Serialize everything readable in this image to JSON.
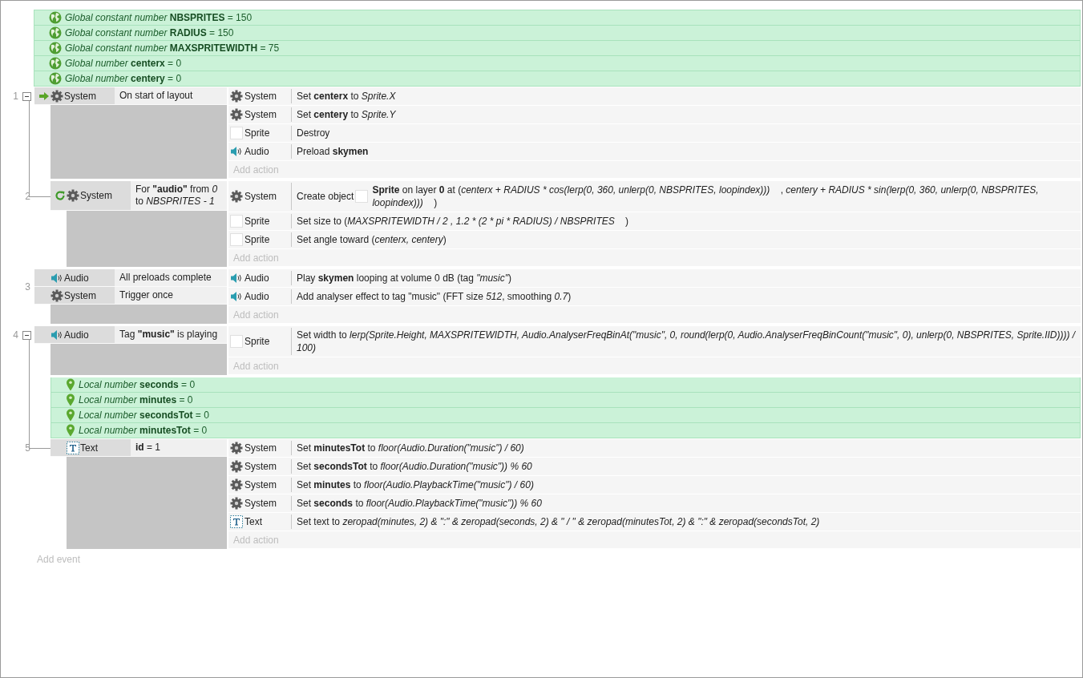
{
  "sheet": [
    {
      "kind": "global",
      "text": "*Global constant number* **NBSPRITES** = 150"
    },
    {
      "kind": "global",
      "text": "*Global constant number* **RADIUS** = 150"
    },
    {
      "kind": "global",
      "text": "*Global constant number* **MAXSPRITEWIDTH** = 75"
    },
    {
      "kind": "global",
      "text": "*Global number* **centerx** = 0"
    },
    {
      "kind": "global",
      "text": "*Global number* **centery** = 0"
    },
    {
      "kind": "event",
      "number": "1",
      "expanded": true,
      "conditions": [
        {
          "trigger": true,
          "loop": false,
          "kind": "system",
          "object": "System",
          "text": "On start of layout"
        }
      ],
      "actions": [
        {
          "kind": "system",
          "object": "System",
          "text": "Set **centerx** to *Sprite.X*"
        },
        {
          "kind": "system",
          "object": "System",
          "text": "Set **centery** to *Sprite.Y*"
        },
        {
          "kind": "sprite",
          "object": "Sprite",
          "text": "Destroy"
        },
        {
          "kind": "audio",
          "object": "Audio",
          "text": "Preload **skymen**"
        }
      ],
      "add_action": "Add action",
      "children": [
        {
          "kind": "event",
          "number": "2",
          "conditions": [
            {
              "trigger": false,
              "loop": true,
              "kind": "system",
              "object": "System",
              "text": "For **\"audio\"** from *0* to *NBSPRITES - 1*"
            }
          ],
          "actions": [
            {
              "kind": "system",
              "object": "System",
              "text_before": "Create object",
              "inline": {
                "kind": "sprite"
              },
              "parts": [
                {
                  "kind": "bold",
                  "text": "Sprite"
                },
                {
                  "kind": "plain",
                  "text": " on layer "
                },
                {
                  "kind": "bold",
                  "text": "0"
                },
                {
                  "kind": "plain",
                  "text": " at ("
                },
                {
                  "kind": "italic",
                  "text": "centerx + RADIUS * cos(lerp(0, 360, unlerp(0, NBSPRITES, loopindex)))"
                },
                {
                  "kind": "plain",
                  "text": "    , "
                },
                {
                  "kind": "italic",
                  "text": "centery + RADIUS * sin(lerp(0, 360, unlerp(0, NBSPRITES, loopindex)))"
                },
                {
                  "kind": "plain",
                  "text": "    )"
                }
              ]
            },
            {
              "kind": "sprite",
              "object": "Sprite",
              "parts": [
                {
                  "kind": "plain",
                  "text": "Set size to ("
                },
                {
                  "kind": "italic",
                  "text": "MAXSPRITEWIDTH / 2 , 1.2 * (2 * pi * RADIUS) / NBSPRITES"
                },
                {
                  "kind": "plain",
                  "text": "    )"
                }
              ]
            },
            {
              "kind": "sprite",
              "object": "Sprite",
              "text": "Set angle toward (*centerx, centery*)"
            }
          ],
          "add_action": "Add action"
        }
      ]
    },
    {
      "kind": "event",
      "number": "3",
      "conditions": [
        {
          "trigger": false,
          "loop": false,
          "kind": "audio",
          "object": "Audio",
          "text": "All preloads complete"
        },
        {
          "trigger": false,
          "loop": false,
          "kind": "system",
          "object": "System",
          "text": "Trigger once"
        }
      ],
      "actions": [
        {
          "kind": "audio",
          "object": "Audio",
          "text": "Play **skymen** looping at volume 0 dB (tag *\"music\"*)"
        },
        {
          "kind": "audio",
          "object": "Audio",
          "text": "Add analyser effect to tag \"music\" (FFT size *512*, smoothing *0.7*)"
        }
      ],
      "add_action": "Add action"
    },
    {
      "kind": "event",
      "number": "4",
      "expanded": true,
      "conditions": [
        {
          "trigger": false,
          "loop": false,
          "kind": "audio",
          "object": "Audio",
          "text": "Tag **\"music\"** is playing"
        }
      ],
      "actions": [
        {
          "kind": "sprite",
          "object": "Sprite",
          "text": "Set width to *lerp(Sprite.Height, MAXSPRITEWIDTH, Audio.AnalyserFreqBinAt(\"music\", 0, round(lerp(0, Audio.AnalyserFreqBinCount(\"music\", 0), unlerp(0, NBSPRITES, Sprite.IID)))) / 100)*"
        }
      ],
      "add_action": "Add action",
      "children": [
        {
          "kind": "local",
          "text": "*Local number* **seconds** = 0"
        },
        {
          "kind": "local",
          "text": "*Local number* **minutes** = 0"
        },
        {
          "kind": "local",
          "text": "*Local number* **secondsTot** = 0"
        },
        {
          "kind": "local",
          "text": "*Local number* **minutesTot** = 0"
        },
        {
          "kind": "event",
          "number": "5",
          "conditions": [
            {
              "trigger": false,
              "loop": false,
              "kind": "text",
              "object": "Text",
              "text": "**id** = 1"
            }
          ],
          "actions": [
            {
              "kind": "system",
              "object": "System",
              "text": "Set **minutesTot** to *floor(Audio.Duration(\"music\") / 60)*"
            },
            {
              "kind": "system",
              "object": "System",
              "text": "Set **secondsTot** to *floor(Audio.Duration(\"music\")) % 60*"
            },
            {
              "kind": "system",
              "object": "System",
              "text": "Set **minutes** to *floor(Audio.PlaybackTime(\"music\") / 60)*"
            },
            {
              "kind": "system",
              "object": "System",
              "text": "Set **seconds** to *floor(Audio.PlaybackTime(\"music\")) % 60*"
            },
            {
              "kind": "text",
              "object": "Text",
              "text": "Set text to *zeropad(minutes, 2) & \":\" & zeropad(seconds, 2) & \" / \" & zeropad(minutesTot, 2) & \":\" & zeropad(secondsTot, 2)*"
            }
          ],
          "add_action": "Add action"
        }
      ]
    }
  ],
  "add_event": "Add event"
}
